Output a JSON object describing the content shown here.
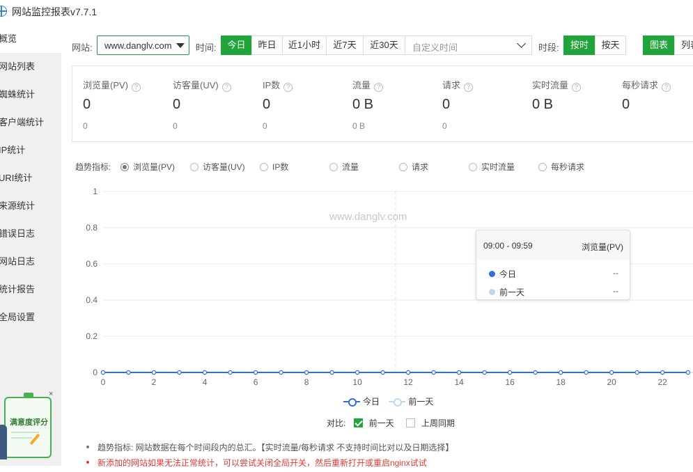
{
  "app": {
    "title": "网站监控报表v7.7.1"
  },
  "sidebar": {
    "items": [
      {
        "label": "概览",
        "active": true
      },
      {
        "label": "网站列表"
      },
      {
        "label": "蜘蛛统计"
      },
      {
        "label": "客户端统计"
      },
      {
        "label": "IP统计"
      },
      {
        "label": "URI统计"
      },
      {
        "label": "来源统计"
      },
      {
        "label": "错误日志"
      },
      {
        "label": "网站日志"
      },
      {
        "label": "统计报告"
      },
      {
        "label": "全局设置"
      }
    ],
    "rating_badge": {
      "label": "满意度评分",
      "close": "×"
    }
  },
  "filters": {
    "site_label": "网站:",
    "site_value": "www.danglv.com",
    "time_label": "时间:",
    "time_buttons": [
      "今日",
      "昨日",
      "近1小时",
      "近7天",
      "近30天"
    ],
    "time_selected": "今日",
    "custom_time_placeholder": "自定义时间",
    "period_label": "时段:",
    "period_buttons": [
      "按时",
      "按天"
    ],
    "period_selected": "按时",
    "view_buttons": [
      "图表",
      "列表"
    ],
    "view_selected": "图表"
  },
  "stats": [
    {
      "name": "浏览量(PV)",
      "value": "0",
      "sub": "0"
    },
    {
      "name": "访客量(UV)",
      "value": "0",
      "sub": "0"
    },
    {
      "name": "IP数",
      "value": "0",
      "sub": "0"
    },
    {
      "name": "流量",
      "value": "0 B",
      "sub": "0 B"
    },
    {
      "name": "请求",
      "value": "0",
      "sub": "0"
    },
    {
      "name": "实时流量",
      "value": "0 B",
      "sub": ""
    },
    {
      "name": "每秒请求",
      "value": "0",
      "sub": ""
    }
  ],
  "trend": {
    "label": "趋势指标:",
    "options": [
      "浏览量(PV)",
      "访客量(UV)",
      "IP数",
      "流量",
      "请求",
      "实时流量",
      "每秒请求"
    ],
    "selected": "浏览量(PV)"
  },
  "watermark": "www.danglv.com",
  "tooltip": {
    "time": "09:00 - 09:59",
    "metric": "浏览量(PV)",
    "rows": [
      {
        "name": "今日",
        "value": "--",
        "color": "#2f6fd6"
      },
      {
        "name": "前一天",
        "value": "--",
        "color": "#b8d9f5"
      }
    ]
  },
  "legend": {
    "items": [
      {
        "name": "今日",
        "color": "#2f6fd6"
      },
      {
        "name": "前一天",
        "color": "#b8d9f5"
      }
    ]
  },
  "compare": {
    "label": "对比:",
    "options": [
      {
        "name": "前一天",
        "checked": true
      },
      {
        "name": "上周同期",
        "checked": false
      }
    ]
  },
  "notes": [
    {
      "text": "趋势指标: 网站数据在每个时间段内的总汇。【实时流量/每秒请求 不支持时间比对以及日期选择】",
      "color": "gray"
    },
    {
      "text": "新添加的网站如果无法正常统计，可以尝试关闭全局开关，然后重新打开或重启nginx试试",
      "color": "red"
    }
  ],
  "chart_data": {
    "type": "line",
    "x": [
      0,
      1,
      2,
      3,
      4,
      5,
      6,
      7,
      8,
      9,
      10,
      11,
      12,
      13,
      14,
      15,
      16,
      17,
      18,
      19,
      20,
      21,
      22,
      23
    ],
    "x_ticks": [
      "0",
      "2",
      "4",
      "6",
      "8",
      "10",
      "12",
      "14",
      "16",
      "18",
      "20",
      "22"
    ],
    "y_ticks": [
      "0",
      "0.2",
      "0.4",
      "0.6",
      "0.8",
      "1"
    ],
    "ylim": [
      0,
      1
    ],
    "xlim": [
      0,
      23
    ],
    "grid": true,
    "series": [
      {
        "name": "今日",
        "color": "#2f6fd6",
        "values": [
          0,
          0,
          0,
          0,
          0,
          0,
          0,
          0,
          0,
          0,
          0,
          0,
          0,
          0,
          0,
          0,
          0,
          0,
          0,
          0,
          0,
          0,
          0,
          0
        ]
      },
      {
        "name": "前一天",
        "color": "#b8d9f5",
        "values": [
          0,
          0,
          0,
          0,
          0,
          0,
          0,
          0,
          0,
          0,
          0,
          0,
          0,
          0,
          0,
          0,
          0,
          0,
          0,
          0,
          0,
          0,
          0,
          0
        ]
      }
    ],
    "hover_index": 11.5
  }
}
